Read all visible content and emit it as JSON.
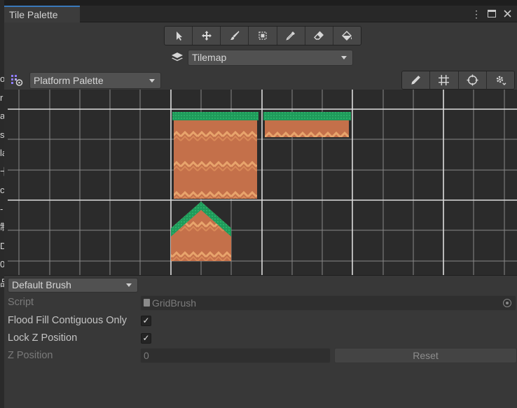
{
  "window": {
    "tab_title": "Tile Palette",
    "menu_icon": "kebab-menu-icon",
    "maximize_icon": "maximize-icon",
    "close_icon": "close-icon"
  },
  "tools": [
    {
      "name": "select",
      "icon": "arrow-pointer-icon"
    },
    {
      "name": "move",
      "icon": "move-icon"
    },
    {
      "name": "paint",
      "icon": "paintbrush-icon"
    },
    {
      "name": "box-fill",
      "icon": "box-fill-icon"
    },
    {
      "name": "pick",
      "icon": "eyedropper-icon"
    },
    {
      "name": "erase",
      "icon": "eraser-icon"
    },
    {
      "name": "fill",
      "icon": "paint-bucket-icon"
    }
  ],
  "target": {
    "icon": "layers-icon",
    "value": "Tilemap"
  },
  "palette": {
    "icon": "palette-icon",
    "value": "Platform Palette"
  },
  "palette_tools": [
    {
      "name": "edit",
      "icon": "pencil-icon"
    },
    {
      "name": "grid",
      "icon": "grid-icon"
    },
    {
      "name": "gizmos",
      "icon": "gizmo-icon"
    },
    {
      "name": "settings",
      "icon": "gear-icon"
    }
  ],
  "brush": {
    "value": "Default Brush"
  },
  "properties": {
    "script_label": "Script",
    "script_value": "GridBrush",
    "flood_fill_label": "Flood Fill Contiguous Only",
    "flood_fill_checked": "✓",
    "lock_z_label": "Lock Z Position",
    "lock_z_checked": "✓",
    "z_position_label": "Z Position",
    "z_position_value": "0",
    "reset_label": "Reset"
  },
  "behind_text": [
    "o",
    "r",
    "a",
    "st",
    "la",
    "卡",
    "ce",
    "-",
    "制",
    "D",
    "0",
    "品"
  ],
  "colors": {
    "accent": "#3a79bb",
    "grass": "#1f9a5a",
    "dirt": "#c4704a",
    "dirt_light": "#e8a46c"
  }
}
